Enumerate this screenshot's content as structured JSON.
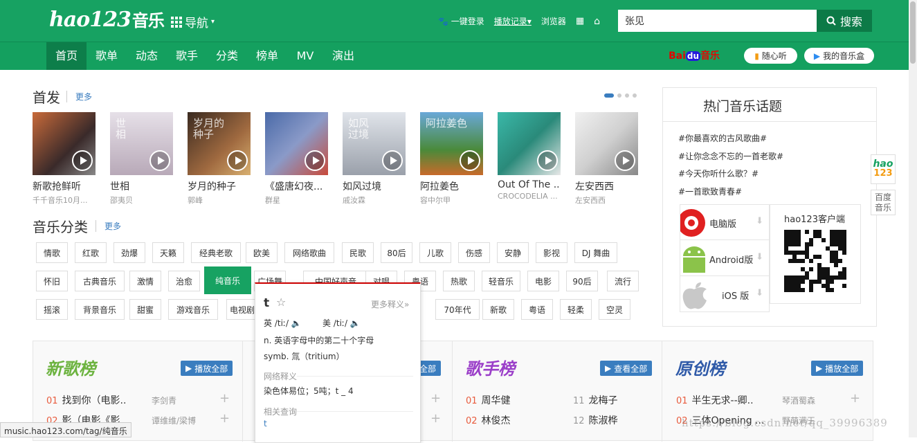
{
  "header": {
    "logo": "hao123",
    "logo_sub": "音乐",
    "nav_menu": "导航",
    "links": [
      "一键登录",
      "播放记录",
      "浏览器"
    ],
    "search_value": "张见",
    "search_button": "搜索"
  },
  "navbar": {
    "items": [
      "首页",
      "歌单",
      "动态",
      "歌手",
      "分类",
      "榜单",
      "MV",
      "演出"
    ],
    "baidu": "Bai",
    "baidu_du": "du",
    "baidu_music": "音乐",
    "pill1": "随心听",
    "pill2": "我的音乐盒"
  },
  "first": {
    "title": "首发",
    "more": "更多",
    "albums": [
      {
        "title": "新歌抢鲜听",
        "artist": "千千音乐10月..."
      },
      {
        "title": "世相",
        "artist": "邵夷贝"
      },
      {
        "title": "岁月的种子",
        "artist": "郭峰"
      },
      {
        "title": "《盛唐幻夜...",
        "artist": "群星"
      },
      {
        "title": "如风过境",
        "artist": "戚汝霖"
      },
      {
        "title": "阿拉姜色",
        "artist": "容中尔甲"
      },
      {
        "title": "Out Of The ...",
        "artist": "CROCODELIA ..."
      },
      {
        "title": "左安西西",
        "artist": "左安西西"
      }
    ],
    "cover_text": [
      "",
      "世\n相",
      "岁月的\n种子",
      "",
      "如风\n过境",
      "阿拉姜色",
      "",
      ""
    ]
  },
  "categories": {
    "title": "音乐分类",
    "more": "更多",
    "row1": [
      "情歌",
      "红歌",
      "劲爆",
      "天籁",
      "经典老歌",
      "欧美",
      "网络歌曲",
      "民歌",
      "80后",
      "儿歌",
      "伤感",
      "安静",
      "影视",
      "DJ 舞曲"
    ],
    "row2": [
      "怀旧",
      "古典音乐",
      "激情",
      "治愈",
      "纯音乐",
      "广场舞",
      "中国好声音",
      "对唱",
      "粤语",
      "热歌",
      "轻音乐",
      "电影",
      "90后",
      "流行"
    ],
    "row3": [
      "摇滚",
      "背景音乐",
      "甜蜜",
      "游戏音乐",
      "电视剧",
      "",
      "",
      "",
      "",
      "70年代",
      "新歌",
      "粤语",
      "轻柔",
      "空灵"
    ]
  },
  "right_panel": {
    "title": "热门音乐话题",
    "topics": [
      "#你最喜欢的古风歌曲#",
      "#让你念念不忘的一首老歌#",
      "#今天你听什么歌？#",
      "#一首歌致青春#"
    ],
    "downloads": [
      "电脑版",
      "Android版",
      "iOS 版"
    ],
    "qr_title": "hao123客户端"
  },
  "side_tabs": {
    "tab1a": "hao",
    "tab1b": "123",
    "tab2": "百度\n音乐"
  },
  "charts": [
    {
      "title": "新歌榜",
      "button": "播放全部",
      "songs": [
        {
          "n": "01",
          "name": "找到你（电影..",
          "artist": "李剑青"
        },
        {
          "n": "02",
          "name": "影（电影《影..",
          "artist": "谭维维/梁博"
        }
      ]
    },
    {
      "title": "",
      "button": "全部",
      "songs": []
    },
    {
      "title": "歌手榜",
      "button": "查看全部",
      "songs": [
        {
          "n": "01",
          "name": "周华健"
        },
        {
          "n": "02",
          "name": "林俊杰"
        },
        {
          "n": "11",
          "name": "龙梅子"
        },
        {
          "n": "12",
          "name": "陈淑桦"
        }
      ]
    },
    {
      "title": "原创榜",
      "button": "播放全部",
      "songs": [
        {
          "n": "01",
          "name": "半生无求--卿..",
          "artist": "琴酒蜀森"
        },
        {
          "n": "02",
          "name": "三体Opening ...",
          "artist": "野萌满王"
        }
      ]
    }
  ],
  "popup": {
    "word": "t",
    "more": "更多释义»",
    "uk": "英 /tiː/",
    "us": "美 /tiː/",
    "def1": "n. 英语字母中的第二十个字母",
    "def2": "symb. 氚（tritium）",
    "web_label": "网络释义",
    "web_def": "染色体易位；5吨；t _ 4",
    "related_label": "相关查询",
    "related": "t"
  },
  "status": "music.hao123.com/tag/纯音乐",
  "watermark": "https://blog.csdn.net/qq_39996389"
}
